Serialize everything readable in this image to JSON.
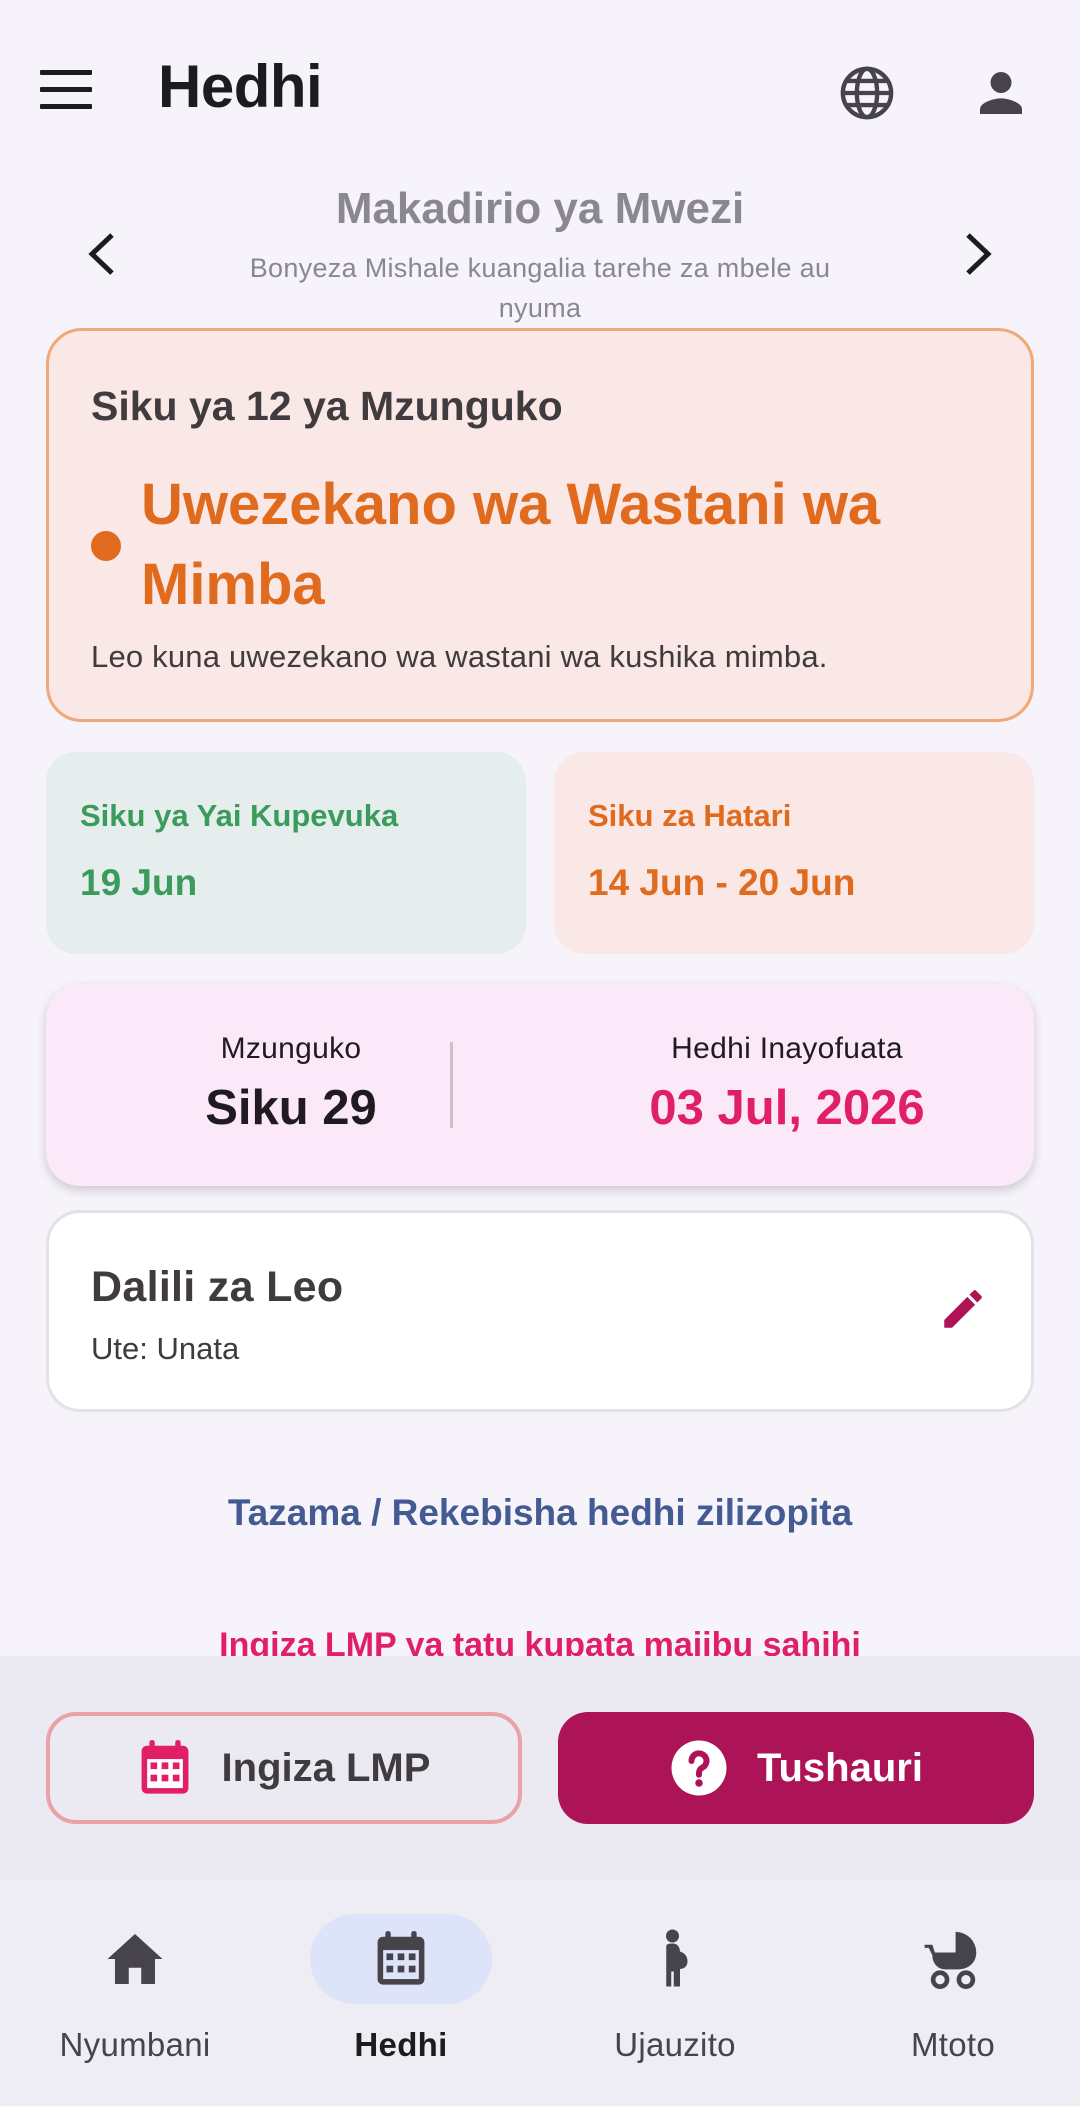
{
  "header": {
    "title": "Hedhi"
  },
  "month_nav": {
    "title": "Makadirio ya Mwezi",
    "subtitle": "Bonyeza Mishale kuangalia tarehe za mbele au nyuma"
  },
  "status_card": {
    "cycle_day": "Siku ya 12 ya Mzunguko",
    "risk_title": "Uwezekano wa Wastani wa Mimba",
    "risk_description": "Leo kuna uwezekano wa wastani wa kushika mimba.",
    "risk_color": "#e06b1f"
  },
  "ovulation": {
    "label": "Siku ya Yai Kupevuka",
    "value": "19 Jun",
    "color": "#3a9b5c"
  },
  "danger_days": {
    "label": "Siku za Hatari",
    "value": "14 Jun - 20 Jun",
    "color": "#e06b1f"
  },
  "cycle": {
    "length_label": "Mzunguko",
    "length_value": "Siku 29",
    "next_period_label": "Hedhi Inayofuata",
    "next_period_value": "03 Jul, 2026",
    "next_period_color": "#e01f66"
  },
  "symptoms": {
    "title": "Dalili za Leo",
    "value": "Ute: Unata",
    "edit_icon": "pencil-icon"
  },
  "links": {
    "history": "Tazama / Rekebisha hedhi zilizopita",
    "lmp_hint": "Ingiza LMP ya tatu kupata majibu sahihi"
  },
  "actions": {
    "lmp_button": "Ingiza LMP",
    "lmp_icon": "calendar-icon",
    "advise_button": "Tushauri",
    "advise_icon": "help-circle-icon",
    "primary_color": "#ad1457"
  },
  "bottom_nav": {
    "items": [
      {
        "label": "Nyumbani",
        "icon": "home-icon",
        "active": false
      },
      {
        "label": "Hedhi",
        "icon": "calendar-icon",
        "active": true
      },
      {
        "label": "Ujauzito",
        "icon": "pregnant-woman-icon",
        "active": false
      },
      {
        "label": "Mtoto",
        "icon": "stroller-icon",
        "active": false
      }
    ]
  }
}
